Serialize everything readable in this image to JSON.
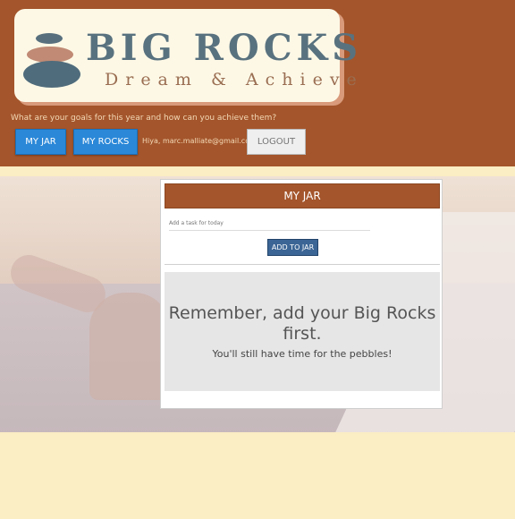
{
  "logo": {
    "title": "BIG ROCKS",
    "subtitle": "Dream & Achieve"
  },
  "header": {
    "tagline": "What are your goals for this year and how can you achieve them?",
    "nav": {
      "my_jar": "MY JAR",
      "my_rocks": "MY ROCKS"
    },
    "greeting": "Hiya, marc.malliate@gmail.co!",
    "logout": "LOGOUT"
  },
  "panel": {
    "title": "MY JAR",
    "task_placeholder": "Add a task for today",
    "add_button": "ADD TO JAR",
    "empty_heading": "Remember, add your Big Rocks first.",
    "empty_subtext": "You'll still have time for the pebbles!"
  },
  "colors": {
    "header_bg": "#a4552b",
    "button_blue": "#2b88d8",
    "add_button": "#3b6595",
    "page_bg": "#fbedc4"
  }
}
